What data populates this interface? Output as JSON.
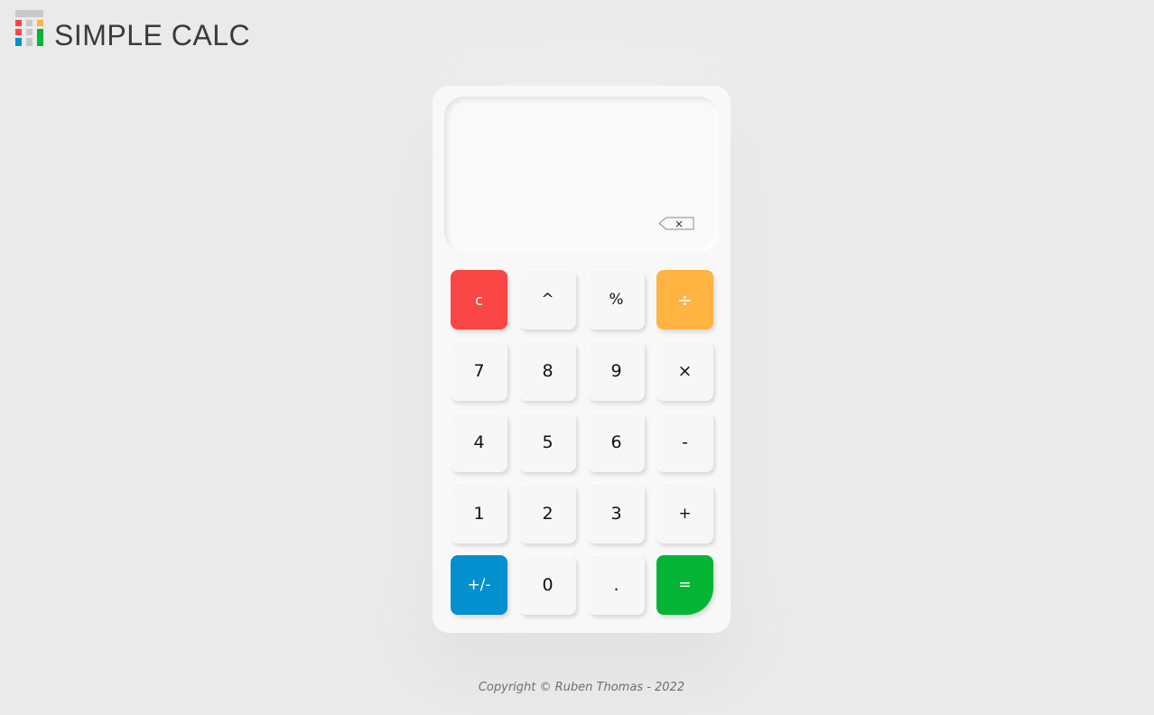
{
  "header": {
    "title": "SIMPLE CALC",
    "logo_icon": "calculator-grid-icon"
  },
  "display": {
    "value": "",
    "backspace_icon": "backspace-icon",
    "backspace_glyph": "×"
  },
  "keys": {
    "clear": "c",
    "power": "^",
    "percent": "%",
    "divide": "÷",
    "seven": "7",
    "eight": "8",
    "nine": "9",
    "multiply": "×",
    "four": "4",
    "five": "5",
    "six": "6",
    "subtract": "-",
    "one": "1",
    "two": "2",
    "three": "3",
    "add": "+",
    "negate": "+/-",
    "zero": "0",
    "decimal": ".",
    "equals": "="
  },
  "colors": {
    "clear": "#fb4646",
    "divide": "#ffb340",
    "negate": "#048fce",
    "equals": "#04b535"
  },
  "footer": {
    "copyright": "Copyright © Ruben Thomas - 2022"
  }
}
